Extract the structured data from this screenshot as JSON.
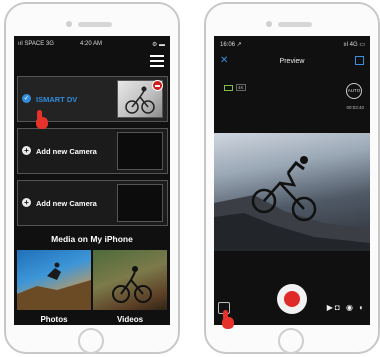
{
  "left_screen": {
    "status": {
      "carrier": "ııl SPACE 3G",
      "time": "4:20 AM",
      "right": "⚙ ▬"
    },
    "cameras": [
      {
        "label": "ISMART DV",
        "connected": true
      },
      {
        "label": "Add new Camera",
        "connected": false
      },
      {
        "label": "Add new Camera",
        "connected": false
      }
    ],
    "media_title": "Media on My iPhone",
    "photos_label": "Photos",
    "videos_label": "Videos"
  },
  "right_screen": {
    "status": {
      "time": "16:06 ↗",
      "right": "ııl 4G ▭"
    },
    "title": "Preview",
    "resolution_badge": "4K",
    "auto_label": "AUTO",
    "counter": "00:03:40",
    "mode_icons": "▶◘ ◉ ◐"
  },
  "colors": {
    "accent": "#2f8ddc",
    "record": "#e02a2a",
    "pointer": "#e5332b"
  }
}
